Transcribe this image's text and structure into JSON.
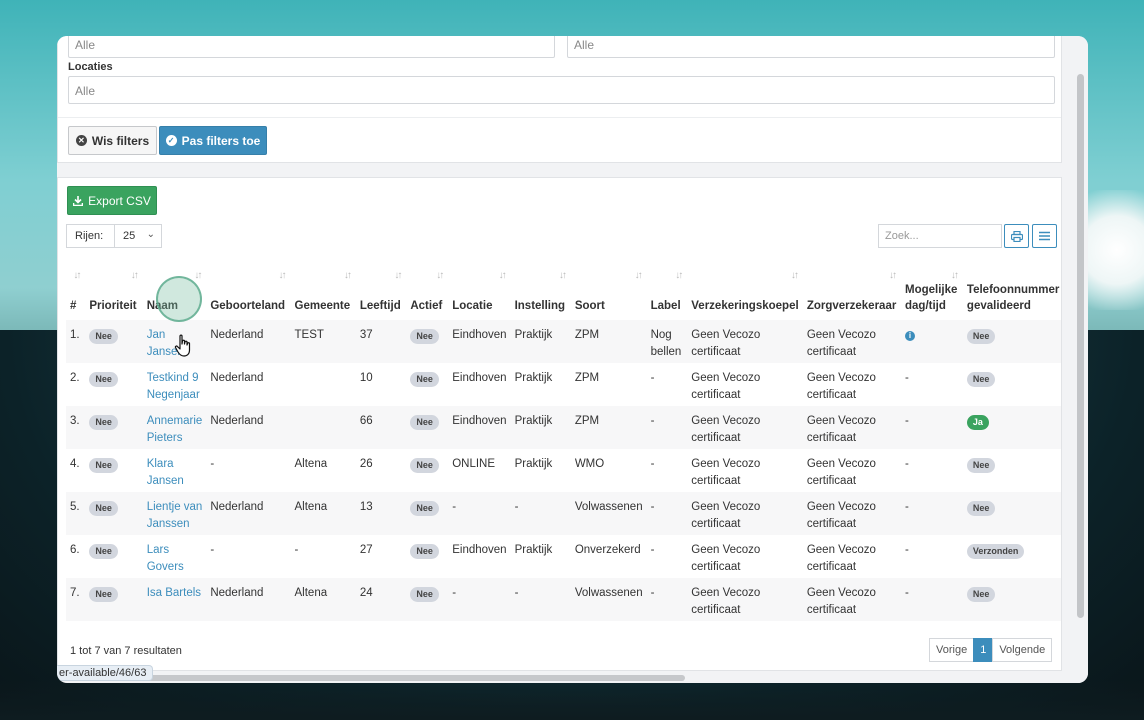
{
  "filters": {
    "select_1_value": "Alle",
    "select_2_value": "Alle",
    "locaties_label": "Locaties",
    "locaties_value": "Alle",
    "clear_button": "Wis filters",
    "apply_button": "Pas filters toe"
  },
  "toolbar": {
    "export_button": "Export CSV",
    "rows_label": "Rijen:",
    "rows_value": "25",
    "search_placeholder": "Zoek...",
    "print_icon": "print-icon",
    "columns_icon": "list-icon"
  },
  "table": {
    "columns": [
      "#",
      "Prioriteit",
      "Naam",
      "Geboorteland",
      "Gemeente",
      "Leeftijd",
      "Actief",
      "Locatie",
      "Instelling",
      "Soort",
      "Label",
      "Verzekeringskoepel",
      "Zorgverzekeraar",
      "Mogelijke dag/tijd",
      "Telefoonnummer gevalideerd"
    ],
    "rows": [
      {
        "nr": "1.",
        "prioriteit": "Nee",
        "naam": "Jan Jansen",
        "geboorteland": "Nederland",
        "gemeente": "TEST",
        "leeftijd": "37",
        "actief": "Nee",
        "locatie": "Eindhoven",
        "instelling": "Praktijk",
        "soort": "ZPM",
        "label": "Nog bellen",
        "koepel": "Geen Vecozo certificaat",
        "zorgverzekeraar": "Geen Vecozo certificaat",
        "dagtijd": "",
        "telefoon": "Nee"
      },
      {
        "nr": "2.",
        "prioriteit": "Nee",
        "naam": "Testkind 9 Negenjaar",
        "geboorteland": "Nederland",
        "gemeente": "",
        "leeftijd": "10",
        "actief": "Nee",
        "locatie": "Eindhoven",
        "instelling": "Praktijk",
        "soort": "ZPM",
        "label": "-",
        "koepel": "Geen Vecozo certificaat",
        "zorgverzekeraar": "Geen Vecozo certificaat",
        "dagtijd": "-",
        "telefoon": "Nee"
      },
      {
        "nr": "3.",
        "prioriteit": "Nee",
        "naam": "Annemarie Pieters",
        "geboorteland": "Nederland",
        "gemeente": "",
        "leeftijd": "66",
        "actief": "Nee",
        "locatie": "Eindhoven",
        "instelling": "Praktijk",
        "soort": "ZPM",
        "label": "-",
        "koepel": "Geen Vecozo certificaat",
        "zorgverzekeraar": "Geen Vecozo certificaat",
        "dagtijd": "-",
        "telefoon": "Ja"
      },
      {
        "nr": "4.",
        "prioriteit": "Nee",
        "naam": "Klara Jansen",
        "geboorteland": "-",
        "gemeente": "Altena",
        "leeftijd": "26",
        "actief": "Nee",
        "locatie": "ONLINE",
        "instelling": "Praktijk",
        "soort": "WMO",
        "label": "-",
        "koepel": "Geen Vecozo certificaat",
        "zorgverzekeraar": "Geen Vecozo certificaat",
        "dagtijd": "-",
        "telefoon": "Nee"
      },
      {
        "nr": "5.",
        "prioriteit": "Nee",
        "naam": "Lientje van Janssen",
        "geboorteland": "Nederland",
        "gemeente": "Altena",
        "leeftijd": "13",
        "actief": "Nee",
        "locatie": "-",
        "instelling": "-",
        "soort": "Volwassenen",
        "label": "-",
        "koepel": "Geen Vecozo certificaat",
        "zorgverzekeraar": "Geen Vecozo certificaat",
        "dagtijd": "-",
        "telefoon": "Nee"
      },
      {
        "nr": "6.",
        "prioriteit": "Nee",
        "naam": "Lars Govers",
        "geboorteland": "-",
        "gemeente": "-",
        "leeftijd": "27",
        "actief": "Nee",
        "locatie": "Eindhoven",
        "instelling": "Praktijk",
        "soort": "Onverzekerd",
        "label": "-",
        "koepel": "Geen Vecozo certificaat",
        "zorgverzekeraar": "Geen Vecozo certificaat",
        "dagtijd": "-",
        "telefoon": "Verzonden"
      },
      {
        "nr": "7.",
        "prioriteit": "Nee",
        "naam": "Isa Bartels",
        "geboorteland": "Nederland",
        "gemeente": "Altena",
        "leeftijd": "24",
        "actief": "Nee",
        "locatie": "-",
        "instelling": "-",
        "soort": "Volwassenen",
        "label": "-",
        "koepel": "Geen Vecozo certificaat",
        "zorgverzekeraar": "Geen Vecozo certificaat",
        "dagtijd": "-",
        "telefoon": "Nee"
      }
    ]
  },
  "footer": {
    "results_text": "1 tot 7 van 7 resultaten",
    "prev": "Vorige",
    "page": "1",
    "next": "Volgende"
  },
  "status_url": "er-available/46/63",
  "colors": {
    "primary": "#3c8dbc",
    "success": "#3aa35f",
    "badge_grey": "#d2d6de"
  }
}
